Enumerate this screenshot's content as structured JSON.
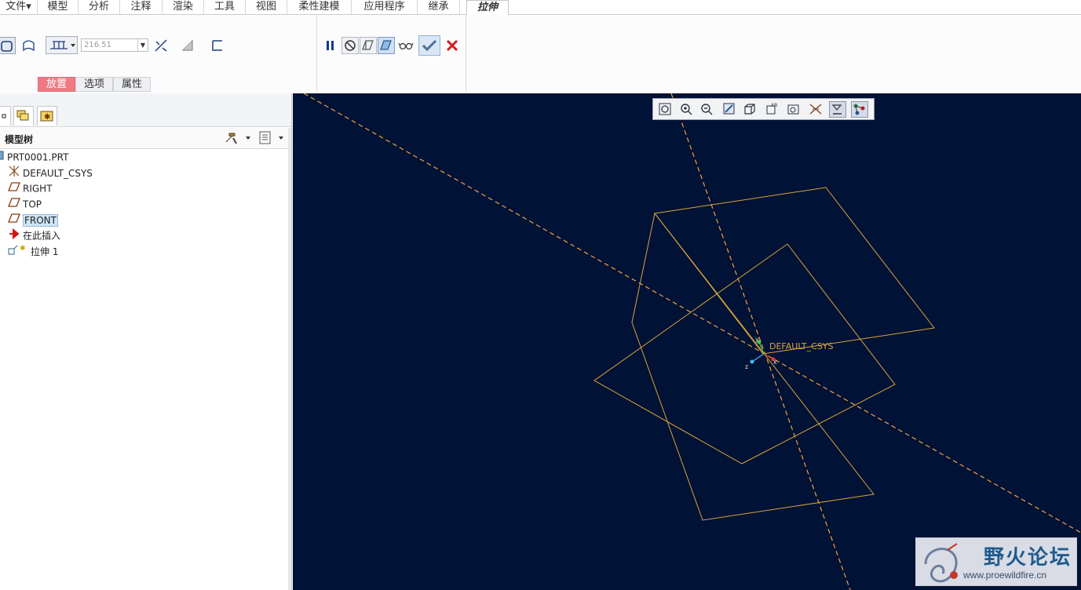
{
  "menu": {
    "tabs": [
      {
        "label": "文件▾"
      },
      {
        "label": "模型"
      },
      {
        "label": "分析"
      },
      {
        "label": "注释"
      },
      {
        "label": "渲染"
      },
      {
        "label": "工具"
      },
      {
        "label": "视图"
      },
      {
        "label": "柔性建模"
      },
      {
        "label": "应用程序"
      },
      {
        "label": "继承"
      },
      {
        "label": "拉伸"
      }
    ]
  },
  "ribbon": {
    "depth_value": "216.51",
    "subtabs": [
      {
        "label": "放置"
      },
      {
        "label": "选项"
      },
      {
        "label": "属性"
      }
    ]
  },
  "model_tree": {
    "title": "模型树",
    "items": [
      {
        "label": "PRT0001.PRT"
      },
      {
        "label": "DEFAULT_CSYS"
      },
      {
        "label": "RIGHT"
      },
      {
        "label": "TOP"
      },
      {
        "label": "FRONT"
      },
      {
        "label": "在此插入"
      },
      {
        "label": "拉伸 1"
      }
    ]
  },
  "viewport": {
    "csys_label": "DEFAULT_CSYS",
    "axis_x": "x",
    "axis_y": "y",
    "axis_z": "z",
    "background_color": "#001235",
    "datum_color": "#d9a43b"
  },
  "watermark": {
    "title": "野火论坛",
    "url": "www.proewildfire.cn"
  }
}
